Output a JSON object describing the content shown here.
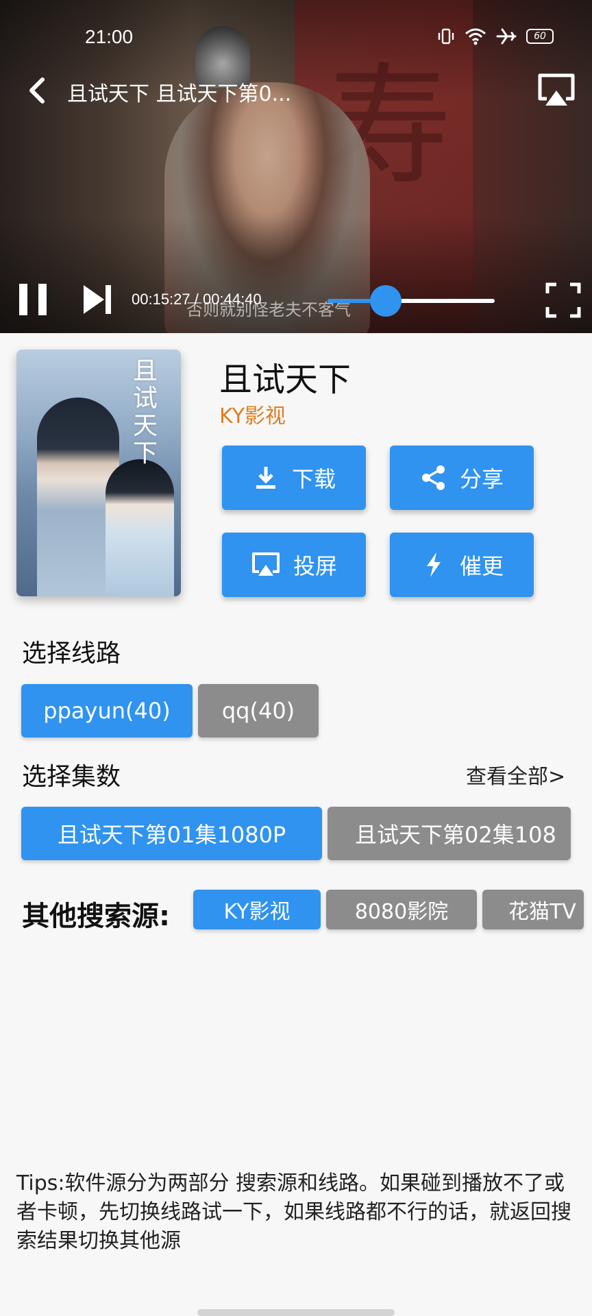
{
  "status_bar": {
    "time": "21:00",
    "battery": "60",
    "icons": [
      "vibrate-icon",
      "wifi-icon",
      "airplane-icon",
      "battery-icon"
    ]
  },
  "player": {
    "title": "且试天下 且试天下第0...",
    "current_time": "00:15:27",
    "separator": "/",
    "total_time": "00:44:40",
    "progress": 0.35,
    "subtitle": "否则就别怪老夫不客气",
    "accent_color": "#2f93ef"
  },
  "show": {
    "title": "且试天下",
    "source": "KY影视",
    "poster_title": "且试天下",
    "source_color": "#e07d1f"
  },
  "actions": {
    "download": "下载",
    "share": "分享",
    "cast": "投屏",
    "urge": "催更"
  },
  "routes": {
    "title": "选择线路",
    "items": [
      {
        "label": "ppayun(40)",
        "active": true
      },
      {
        "label": "qq(40)",
        "active": false
      }
    ]
  },
  "episodes": {
    "title": "选择集数",
    "view_all": "查看全部>",
    "items": [
      {
        "label": "且试天下第01集1080P",
        "active": true
      },
      {
        "label": "且试天下第02集108",
        "active": false
      }
    ]
  },
  "other_sources": {
    "title": "其他搜索源:",
    "items": [
      {
        "label": "KY影视",
        "active": true
      },
      {
        "label": "8080影院",
        "active": false
      },
      {
        "label": "花猫TV",
        "active": false
      }
    ]
  },
  "tips": "Tips:软件源分为两部分 搜索源和线路。如果碰到播放不了或者卡顿，先切换线路试一下，如果线路都不行的话，就返回搜索结果切换其他源"
}
